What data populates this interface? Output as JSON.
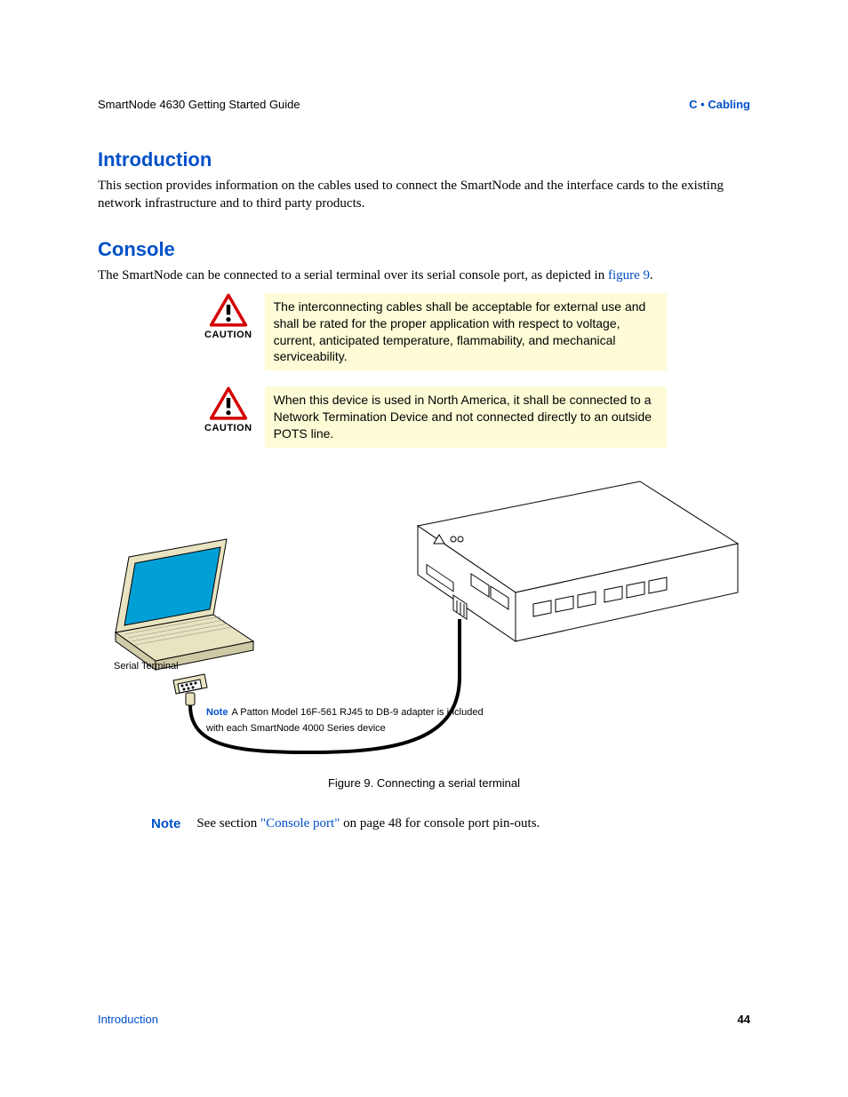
{
  "header": {
    "left": "SmartNode 4630 Getting Started Guide",
    "right": "C • Cabling"
  },
  "sections": {
    "introduction": {
      "title": "Introduction",
      "body": "This section provides information on the cables used to connect the SmartNode and the interface cards to the existing network infrastructure and to third party products."
    },
    "console": {
      "title": "Console",
      "body_prefix": "The SmartNode can be connected to a serial terminal over its serial console port, as depicted in ",
      "body_link": "figure 9",
      "body_suffix": "."
    }
  },
  "cautions": [
    {
      "label": "CAUTION",
      "text": "The interconnecting cables shall be acceptable for external use and shall be rated for the proper application with respect to voltage, current, anticipated temperature, flammability, and mechanical serviceability."
    },
    {
      "label": "CAUTION",
      "text": "When this device is used in North America, it shall be connected to a Network Termination Device and not connected directly to an outside POTS line."
    }
  ],
  "figure": {
    "serial_terminal_label": "Serial Terminal",
    "note_label": "Note",
    "note_text": "A Patton Model 16F-561 RJ45 to DB-9 adapter is included with each SmartNode 4000 Series device",
    "caption": "Figure 9. Connecting a serial terminal"
  },
  "bottom_note": {
    "label": "Note",
    "prefix": "See section ",
    "link": "\"Console port\"",
    "suffix": " on page 48 for console port pin-outs."
  },
  "footer": {
    "left": "Introduction",
    "right": "44"
  }
}
